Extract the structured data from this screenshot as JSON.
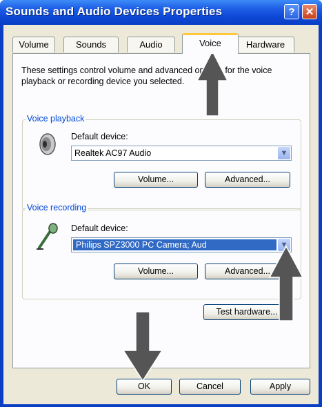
{
  "window": {
    "title": "Sounds and Audio Devices Properties",
    "help_label": "?",
    "close_label": "✕"
  },
  "tabs": [
    {
      "label": "Volume"
    },
    {
      "label": "Sounds"
    },
    {
      "label": "Audio"
    },
    {
      "label": "Voice"
    },
    {
      "label": "Hardware"
    }
  ],
  "active_tab": "Voice",
  "description": "These settings control volume and advanced options for the voice playback or recording device you selected.",
  "voice_playback": {
    "legend": "Voice playback",
    "device_label": "Default device:",
    "device_value": "Realtek AC97 Audio",
    "volume_button": "Volume...",
    "advanced_button": "Advanced...",
    "icon": "speaker-icon"
  },
  "voice_recording": {
    "legend": "Voice recording",
    "device_label": "Default device:",
    "device_value": "Philips SPZ3000 PC Camera; Aud",
    "volume_button": "Volume...",
    "advanced_button": "Advanced...",
    "icon": "microphone-icon"
  },
  "test_hardware_button": "Test hardware...",
  "footer": {
    "ok": "OK",
    "cancel": "Cancel",
    "apply": "Apply"
  },
  "colors": {
    "title_bar": "#0a3fc4",
    "dialog_bg": "#ece9d8",
    "legend": "#0046d5",
    "selection": "#316ac5",
    "annotation_arrow": "#555555"
  }
}
